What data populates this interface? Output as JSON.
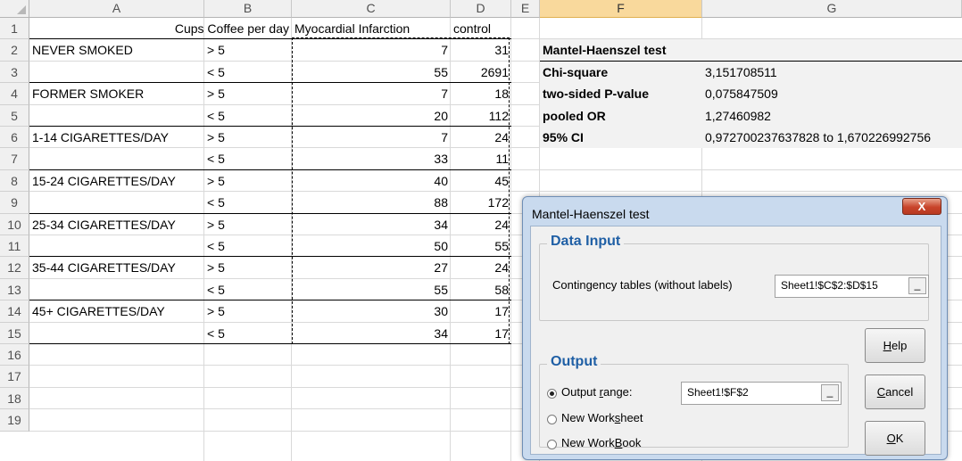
{
  "columns": [
    "A",
    "B",
    "C",
    "D",
    "E",
    "F",
    "G"
  ],
  "selected_column": "F",
  "rows": [
    "1",
    "2",
    "3",
    "4",
    "5",
    "6",
    "7",
    "8",
    "9",
    "10",
    "11",
    "12",
    "13",
    "14",
    "15",
    "16",
    "17",
    "18",
    "19"
  ],
  "table": {
    "header": {
      "b": "Cups Coffee per day",
      "c": "Myocardial Infarction",
      "d": "control"
    },
    "data": [
      {
        "a": "NEVER SMOKED",
        "b": "> 5",
        "c": "7",
        "d": "31"
      },
      {
        "a": "",
        "b": "< 5",
        "c": "55",
        "d": "2691"
      },
      {
        "a": "FORMER SMOKER",
        "b": "> 5",
        "c": "7",
        "d": "18"
      },
      {
        "a": "",
        "b": "< 5",
        "c": "20",
        "d": "112"
      },
      {
        "a": "1-14 CIGARETTES/DAY",
        "b": "> 5",
        "c": "7",
        "d": "24"
      },
      {
        "a": "",
        "b": "< 5",
        "c": "33",
        "d": "11"
      },
      {
        "a": "15-24 CIGARETTES/DAY",
        "b": "> 5",
        "c": "40",
        "d": "45"
      },
      {
        "a": "",
        "b": "< 5",
        "c": "88",
        "d": "172"
      },
      {
        "a": "25-34 CIGARETTES/DAY",
        "b": "> 5",
        "c": "34",
        "d": "24"
      },
      {
        "a": "",
        "b": "< 5",
        "c": "50",
        "d": "55"
      },
      {
        "a": "35-44 CIGARETTES/DAY",
        "b": "> 5",
        "c": "27",
        "d": "24"
      },
      {
        "a": "",
        "b": "< 5",
        "c": "55",
        "d": "58"
      },
      {
        "a": "45+ CIGARETTES/DAY",
        "b": "> 5",
        "c": "30",
        "d": "17"
      },
      {
        "a": "",
        "b": "< 5",
        "c": "34",
        "d": "17"
      }
    ]
  },
  "results": {
    "title": "Mantel-Haenszel test",
    "rows": [
      {
        "label": "Chi-square",
        "value": "3,151708511"
      },
      {
        "label": "two-sided P-value",
        "value": "0,075847509"
      },
      {
        "label": "pooled OR",
        "value": "1,27460982"
      },
      {
        "label": "95% CI",
        "value": "0,972700237637828 to 1,670226992756"
      }
    ]
  },
  "dialog": {
    "title": "Mantel-Haenszel test",
    "close_label": "X",
    "data_input": {
      "title": "Data Input",
      "label": "Contingency tables (without labels)",
      "value": "Sheet1!$C$2:$D$15"
    },
    "output": {
      "title": "Output",
      "options": [
        {
          "label_pre": "Output ",
          "label_key": "r",
          "label_post": "ange:",
          "selected": true
        },
        {
          "label_pre": "New Work",
          "label_key": "s",
          "label_post": "heet",
          "selected": false
        },
        {
          "label_pre": "New Work",
          "label_key": "B",
          "label_post": "ook",
          "selected": false
        }
      ],
      "range_value": "Sheet1!$F$2"
    },
    "buttons": {
      "help": {
        "key": "H",
        "rest": "elp"
      },
      "cancel": {
        "key": "C",
        "rest": "ancel"
      },
      "ok": {
        "key": "O",
        "rest": "K"
      }
    },
    "picker_glyph": "_"
  },
  "colors": {
    "selected_header": "#f9d99c",
    "group_title": "#1f5fa5",
    "shade": "#f2f2f2"
  }
}
